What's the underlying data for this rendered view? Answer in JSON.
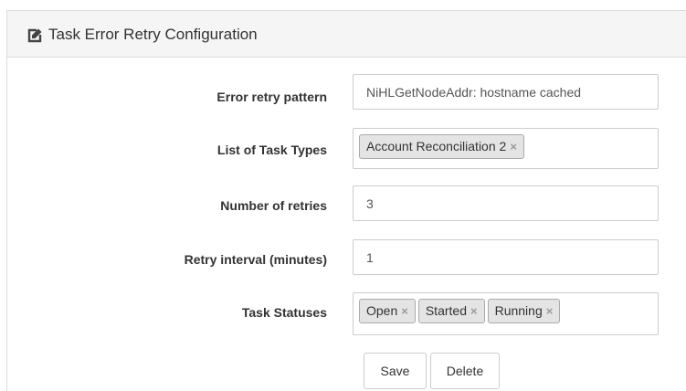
{
  "panel": {
    "title": "Task Error Retry Configuration",
    "icon": "edit-icon"
  },
  "form": {
    "error_retry_pattern": {
      "label": "Error retry pattern",
      "value": "NiHLGetNodeAddr: hostname cached"
    },
    "task_types": {
      "label": "List of Task Types",
      "tags": [
        "Account Reconciliation 2"
      ]
    },
    "number_of_retries": {
      "label": "Number of retries",
      "value": "3"
    },
    "retry_interval": {
      "label": "Retry interval (minutes)",
      "value": "1"
    },
    "task_statuses": {
      "label": "Task Statuses",
      "tags": [
        "Open",
        "Started",
        "Running"
      ]
    }
  },
  "buttons": {
    "save_label": "Save",
    "delete_label": "Delete"
  },
  "tag_remove_glyph": "×",
  "colors": {
    "heading_bg": "#f5f5f5",
    "tag_bg": "#e4e4e4",
    "border": "#cccccc"
  }
}
